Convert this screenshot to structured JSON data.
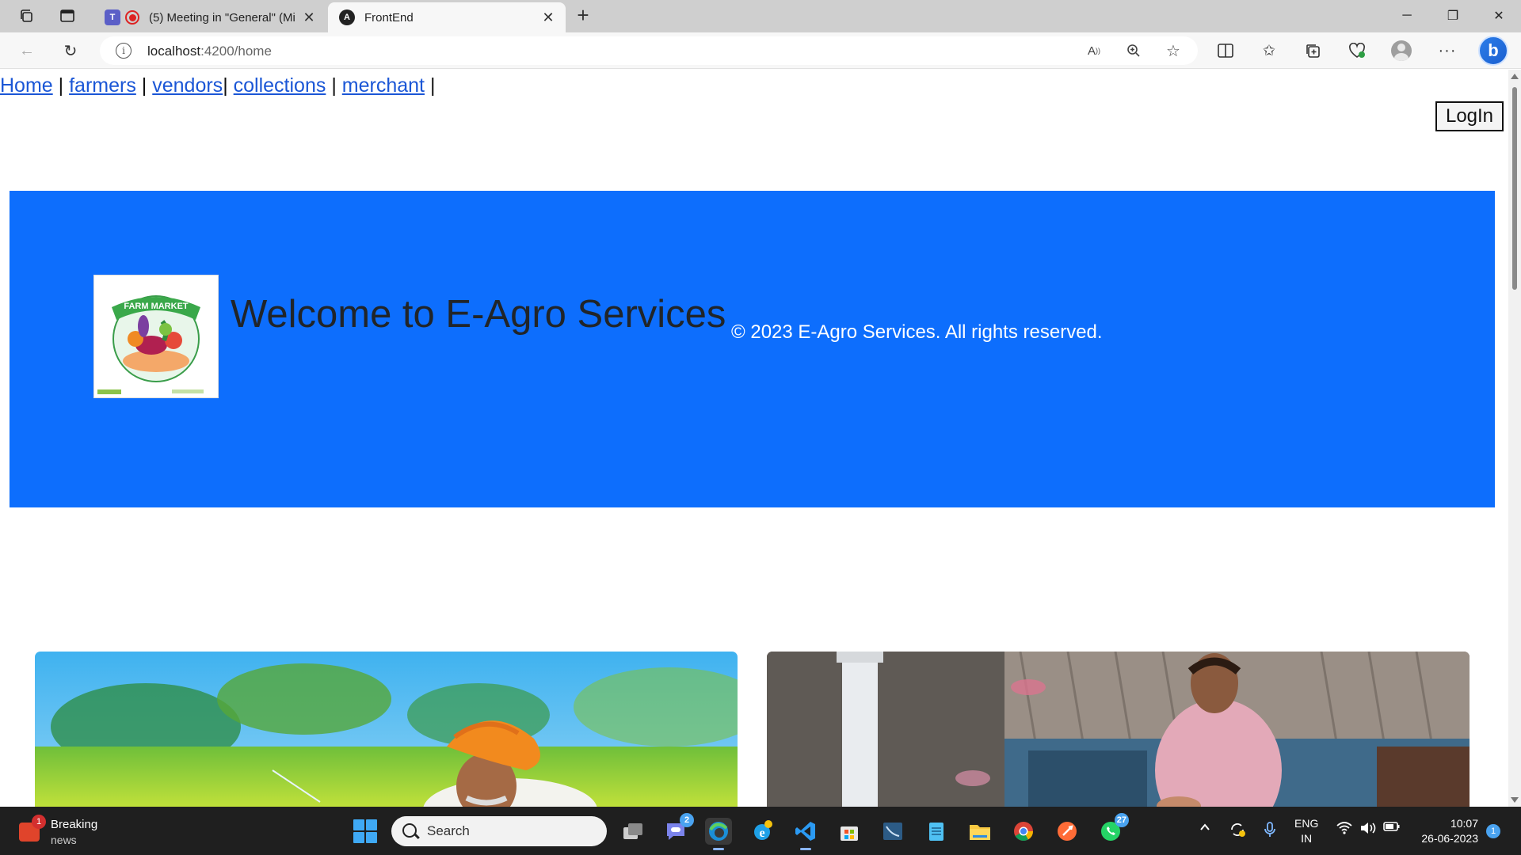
{
  "browser": {
    "tabs": [
      {
        "title": "(5) Meeting in \"General\" (Mi",
        "active": false
      },
      {
        "title": "FrontEnd",
        "active": true
      }
    ],
    "url_host": "localhost",
    "url_path": ":4200/home"
  },
  "page": {
    "nav": {
      "home": "Home",
      "farmers": "farmers",
      "vendors": "vendors",
      "collections": "collections",
      "merchant": "merchant",
      "sep": "|"
    },
    "login_label": "LogIn",
    "hero": {
      "logo_text": "FARM MARKET",
      "title": "Welcome to E-Agro Services",
      "copyright": "© 2023 E-Agro Services. All rights reserved."
    }
  },
  "taskbar": {
    "news_badge": "1",
    "news_line1": "Breaking",
    "news_line2": "news",
    "search_label": "Search",
    "teams_badge": "2",
    "whatsapp_badge": "27",
    "lang_line1": "ENG",
    "lang_line2": "IN",
    "time": "10:07",
    "date": "26-06-2023",
    "notification_count": "1"
  },
  "colors": {
    "hero_bg": "#0d6efd",
    "link": "#1a56d6",
    "taskbar_bg": "#1f1f1f"
  }
}
